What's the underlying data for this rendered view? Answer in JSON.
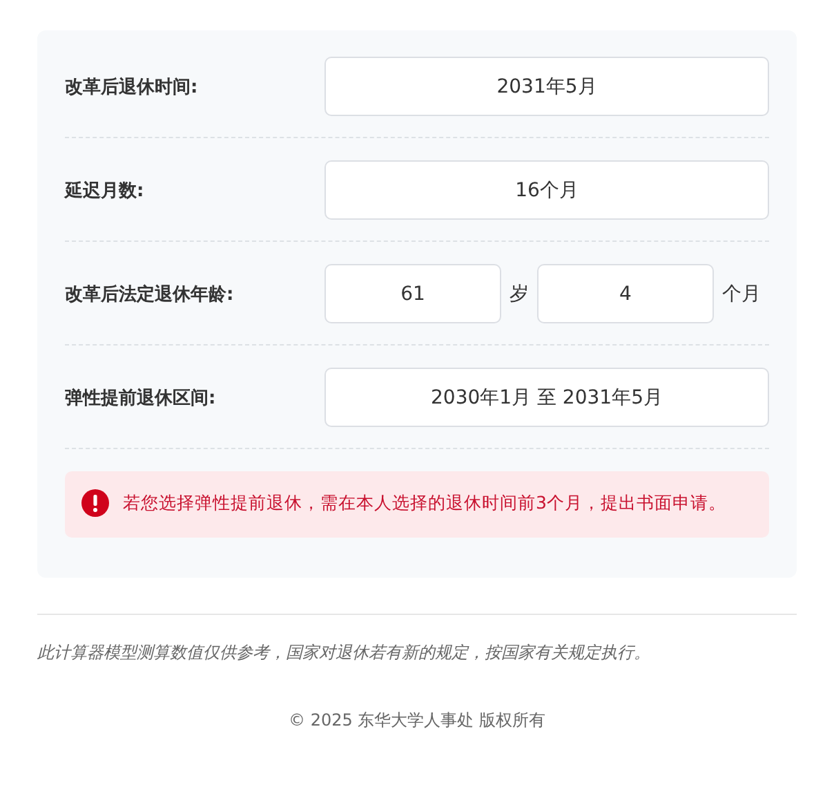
{
  "rows": [
    {
      "kind": "single",
      "label": "改革后退休时间:",
      "value": "2031年5月"
    },
    {
      "kind": "single",
      "label": "延迟月数:",
      "value": "16个月"
    },
    {
      "kind": "pair",
      "label": "改革后法定退休年龄:",
      "fields": [
        {
          "value": "61",
          "unit": "岁"
        },
        {
          "value": "4",
          "unit": "个月"
        }
      ]
    },
    {
      "kind": "single",
      "label": "弹性提前退休区间:",
      "value": "2030年1月 至 2031年5月"
    }
  ],
  "notice": {
    "text": "若您选择弹性提前退休，需在本人选择的退休时间前3个月，提出书面申请。"
  },
  "disclaimer": "此计算器模型测算数值仅供参考，国家对退休若有新的规定，按国家有关规定执行。",
  "footer": "© 2025 东华大学人事处 版权所有"
}
